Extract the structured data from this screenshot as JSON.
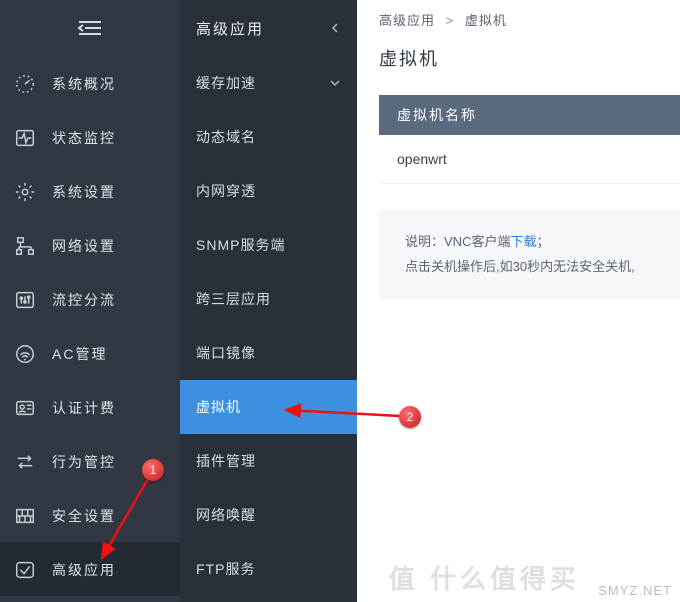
{
  "nav1_items": [
    {
      "icon": "gauge",
      "label": "系统概况"
    },
    {
      "icon": "pulse",
      "label": "状态监控"
    },
    {
      "icon": "gear",
      "label": "系统设置"
    },
    {
      "icon": "net",
      "label": "网络设置"
    },
    {
      "icon": "sliders",
      "label": "流控分流"
    },
    {
      "icon": "wifi",
      "label": "AC管理"
    },
    {
      "icon": "idcard",
      "label": "认证计费"
    },
    {
      "icon": "swap",
      "label": "行为管控"
    },
    {
      "icon": "wall",
      "label": "安全设置"
    },
    {
      "icon": "check",
      "label": "高级应用",
      "active": true
    }
  ],
  "nav2_header": "高级应用",
  "nav2_items": [
    {
      "label": "缓存加速",
      "expand": true
    },
    {
      "label": "动态域名"
    },
    {
      "label": "内网穿透"
    },
    {
      "label": "SNMP服务端"
    },
    {
      "label": "跨三层应用"
    },
    {
      "label": "端口镜像"
    },
    {
      "label": "虚拟机",
      "active": true
    },
    {
      "label": "插件管理"
    },
    {
      "label": "网络唤醒"
    },
    {
      "label": "FTP服务"
    }
  ],
  "breadcrumb": {
    "a": "高级应用",
    "sep": ">",
    "b": "虚拟机"
  },
  "page_title": "虚拟机",
  "section_head": "虚拟机名称",
  "row_value": "openwrt",
  "note": {
    "prefix": "说明：",
    "l1a": "VNC客户端",
    "link": "下载",
    "l1b": "；",
    "l2": "点击关机操作后,如30秒内无法安全关机,"
  },
  "badges": {
    "b1": "1",
    "b2": "2"
  },
  "watermark_text": "SMYZ.NET",
  "watermark_logo": "值 什么值得买"
}
